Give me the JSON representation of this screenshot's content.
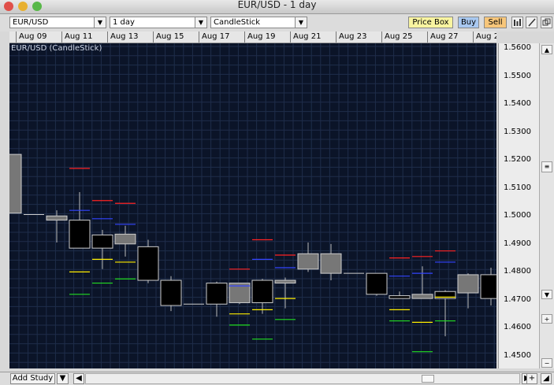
{
  "window": {
    "title": "EUR/USD - 1 day"
  },
  "toolbar": {
    "symbol": "EUR/USD",
    "period": "1 day",
    "chart_type": "CandleStick",
    "price_box_label": "Price Box",
    "buy_label": "Buy",
    "sell_label": "Sell",
    "icon_names": [
      "bar-chart-icon",
      "pencil-icon",
      "detach-icon"
    ]
  },
  "plot": {
    "label": "EUR/USD (CandleStick)"
  },
  "bottom": {
    "add_study_label": "Add Study"
  },
  "colors": {
    "plot_bg": "#0b1428",
    "grid": "#1f2d4a",
    "candle_up": "#777777",
    "candle_down": "#000000",
    "candle_border": "#cccccc",
    "buy_btn": "#a8c8f0",
    "sell_btn": "#f7c67a",
    "price_box_btn": "#f8f4a0"
  },
  "chart_data": {
    "type": "candlestick",
    "x_labels": [
      "Aug 09",
      "Aug 11",
      "Aug 13",
      "Aug 15",
      "Aug 17",
      "Aug 19",
      "Aug 21",
      "Aug 23",
      "Aug 25",
      "Aug 27",
      "Aug 2"
    ],
    "y_ticks": [
      "1.5600",
      "1.5500",
      "1.5400",
      "1.5300",
      "1.5200",
      "1.5100",
      "1.5000",
      "1.4900",
      "1.4800",
      "1.4700",
      "1.4600",
      "1.4500"
    ],
    "ylim": [
      1.445,
      1.5615
    ],
    "grid": true,
    "candles": [
      {
        "date": "Aug 07",
        "open": 1.501,
        "high": 1.522,
        "low": 1.501,
        "close": 1.522
      },
      {
        "date": "Aug 08",
        "open": 1.5005,
        "high": 1.5005,
        "low": 1.5005,
        "close": 1.5005
      },
      {
        "date": "Aug 09",
        "open": 1.4985,
        "high": 1.502,
        "low": 1.4905,
        "close": 1.5
      },
      {
        "date": "Aug 10",
        "open": 1.4985,
        "high": 1.5085,
        "low": 1.491,
        "close": 1.4885
      },
      {
        "date": "Aug 11",
        "open": 1.4932,
        "high": 1.495,
        "low": 1.481,
        "close": 1.4885
      },
      {
        "date": "Aug 12",
        "open": 1.49,
        "high": 1.4965,
        "low": 1.4855,
        "close": 1.4935
      },
      {
        "date": "Aug 13",
        "open": 1.489,
        "high": 1.4915,
        "low": 1.476,
        "close": 1.477
      },
      {
        "date": "Aug 14",
        "open": 1.477,
        "high": 1.4785,
        "low": 1.466,
        "close": 1.468
      },
      {
        "date": "Aug 15",
        "open": 1.4685,
        "high": 1.4685,
        "low": 1.4685,
        "close": 1.4685
      },
      {
        "date": "Aug 16",
        "open": 1.476,
        "high": 1.4765,
        "low": 1.464,
        "close": 1.4685
      },
      {
        "date": "Aug 17",
        "open": 1.469,
        "high": 1.476,
        "low": 1.4685,
        "close": 1.476
      },
      {
        "date": "Aug 18",
        "open": 1.477,
        "high": 1.4775,
        "low": 1.465,
        "close": 1.469
      },
      {
        "date": "Aug 19",
        "open": 1.476,
        "high": 1.478,
        "low": 1.467,
        "close": 1.477
      },
      {
        "date": "Aug 20",
        "open": 1.481,
        "high": 1.4905,
        "low": 1.48,
        "close": 1.4865
      },
      {
        "date": "Aug 21",
        "open": 1.4795,
        "high": 1.49,
        "low": 1.477,
        "close": 1.4865
      },
      {
        "date": "Aug 22",
        "open": 1.4795,
        "high": 1.4795,
        "low": 1.4795,
        "close": 1.4795
      },
      {
        "date": "Aug 23",
        "open": 1.4795,
        "high": 1.4795,
        "low": 1.4715,
        "close": 1.472
      },
      {
        "date": "Aug 24",
        "open": 1.4715,
        "high": 1.473,
        "low": 1.4705,
        "close": 1.4705
      },
      {
        "date": "Aug 25",
        "open": 1.4705,
        "high": 1.482,
        "low": 1.4705,
        "close": 1.472
      },
      {
        "date": "Aug 26",
        "open": 1.473,
        "high": 1.4735,
        "low": 1.457,
        "close": 1.4705
      },
      {
        "date": "Aug 27",
        "open": 1.4725,
        "high": 1.4795,
        "low": 1.467,
        "close": 1.479
      },
      {
        "date": "Aug 28",
        "open": 1.479,
        "high": 1.4815,
        "low": 1.468,
        "close": 1.4705
      }
    ],
    "marker_lines": [
      {
        "i": 3,
        "price": 1.517,
        "color": "#ff2222"
      },
      {
        "i": 3,
        "price": 1.502,
        "color": "#3344ff"
      },
      {
        "i": 3,
        "price": 1.48,
        "color": "#ffee00"
      },
      {
        "i": 3,
        "price": 1.472,
        "color": "#22dd22"
      },
      {
        "i": 4,
        "price": 1.5055,
        "color": "#ff2222"
      },
      {
        "i": 4,
        "price": 1.499,
        "color": "#3344ff"
      },
      {
        "i": 4,
        "price": 1.4845,
        "color": "#ffee00"
      },
      {
        "i": 4,
        "price": 1.476,
        "color": "#22dd22"
      },
      {
        "i": 5,
        "price": 1.5045,
        "color": "#ff2222"
      },
      {
        "i": 5,
        "price": 1.497,
        "color": "#3344ff"
      },
      {
        "i": 5,
        "price": 1.4835,
        "color": "#ffee00"
      },
      {
        "i": 5,
        "price": 1.4775,
        "color": "#22dd22"
      },
      {
        "i": 10,
        "price": 1.481,
        "color": "#ff2222"
      },
      {
        "i": 10,
        "price": 1.475,
        "color": "#3344ff"
      },
      {
        "i": 10,
        "price": 1.465,
        "color": "#ffee00"
      },
      {
        "i": 10,
        "price": 1.461,
        "color": "#22dd22"
      },
      {
        "i": 11,
        "price": 1.4915,
        "color": "#ff2222"
      },
      {
        "i": 11,
        "price": 1.4845,
        "color": "#3344ff"
      },
      {
        "i": 11,
        "price": 1.4665,
        "color": "#ffee00"
      },
      {
        "i": 11,
        "price": 1.456,
        "color": "#22dd22"
      },
      {
        "i": 12,
        "price": 1.486,
        "color": "#ff2222"
      },
      {
        "i": 12,
        "price": 1.4815,
        "color": "#3344ff"
      },
      {
        "i": 12,
        "price": 1.4705,
        "color": "#ffee00"
      },
      {
        "i": 12,
        "price": 1.463,
        "color": "#22dd22"
      },
      {
        "i": 17,
        "price": 1.485,
        "color": "#ff2222"
      },
      {
        "i": 17,
        "price": 1.4785,
        "color": "#3344ff"
      },
      {
        "i": 17,
        "price": 1.4665,
        "color": "#ffee00"
      },
      {
        "i": 17,
        "price": 1.4625,
        "color": "#22dd22"
      },
      {
        "i": 18,
        "price": 1.4855,
        "color": "#ff2222"
      },
      {
        "i": 18,
        "price": 1.4795,
        "color": "#3344ff"
      },
      {
        "i": 18,
        "price": 1.462,
        "color": "#ffee00"
      },
      {
        "i": 18,
        "price": 1.4515,
        "color": "#22dd22"
      },
      {
        "i": 19,
        "price": 1.4875,
        "color": "#ff2222"
      },
      {
        "i": 19,
        "price": 1.4835,
        "color": "#3344ff"
      },
      {
        "i": 19,
        "price": 1.471,
        "color": "#ffee00"
      },
      {
        "i": 19,
        "price": 1.4625,
        "color": "#22dd22"
      }
    ]
  }
}
